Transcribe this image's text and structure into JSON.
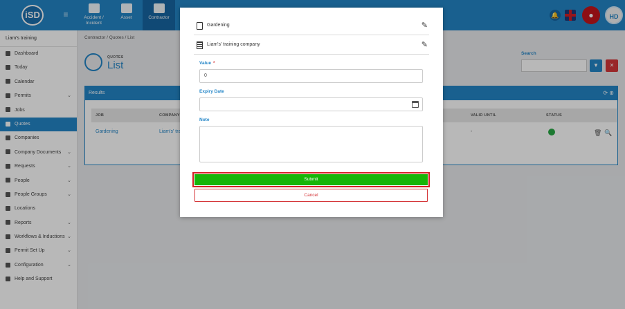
{
  "app": {
    "logo_text": "iSD",
    "modules": [
      {
        "label": "Accident / Incident",
        "icon": "briefcase-icon",
        "active": false
      },
      {
        "label": "Asset",
        "icon": "boxes-icon",
        "active": false
      },
      {
        "label": "Contractor",
        "icon": "hardhat-icon",
        "active": true
      }
    ],
    "avatar_initials": "HD"
  },
  "sidebar": {
    "training": "Liam's training",
    "items": [
      {
        "label": "Dashboard",
        "chevron": false
      },
      {
        "label": "Today",
        "chevron": false
      },
      {
        "label": "Calendar",
        "chevron": false
      },
      {
        "label": "Permits",
        "chevron": true
      },
      {
        "label": "Jobs",
        "chevron": false
      },
      {
        "label": "Quotes",
        "chevron": false,
        "active": true
      },
      {
        "label": "Companies",
        "chevron": false
      },
      {
        "label": "Company Documents",
        "chevron": true
      },
      {
        "label": "Requests",
        "chevron": true
      },
      {
        "label": "People",
        "chevron": true
      },
      {
        "label": "People Groups",
        "chevron": true
      },
      {
        "label": "Locations",
        "chevron": false
      },
      {
        "label": "Reports",
        "chevron": true
      },
      {
        "label": "Workflows & Inductions",
        "chevron": true
      },
      {
        "label": "Permit Set Up",
        "chevron": true
      },
      {
        "label": "Configuration",
        "chevron": true
      },
      {
        "label": "Help and Support",
        "chevron": false
      }
    ]
  },
  "main": {
    "breadcrumb": "Contractor /  Quotes /  List",
    "page_kicker": "QUOTES",
    "page_title": "List",
    "search_label": "Search",
    "results_label": "Results",
    "table": {
      "headers": [
        "JOB",
        "COMPANY",
        "VALID UNTIL",
        "STATUS"
      ],
      "rows": [
        {
          "job": "Gardening",
          "company": "Liam's' tra",
          "valid_until": "-"
        }
      ]
    }
  },
  "modal": {
    "job_name": "Gardening",
    "company_name": "Liam's' training company",
    "value_label": "Value",
    "value_required_mark": "*",
    "value_input": "0",
    "expiry_label": "Expiry Date",
    "expiry_input": "",
    "note_label": "Note",
    "note_input": "",
    "submit_label": "Submit",
    "cancel_label": "Cancel"
  },
  "colors": {
    "primary": "#2385c7",
    "submit_green": "#17b509",
    "danger": "#d53639",
    "highlight_border": "#d51f26"
  }
}
